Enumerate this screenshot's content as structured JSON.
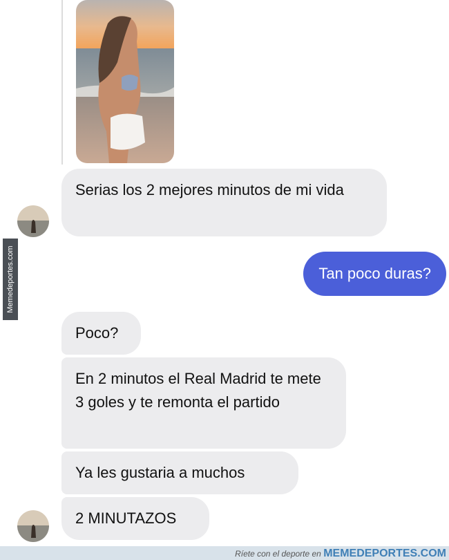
{
  "messages": {
    "received_1": "Serias los 2 mejores minutos de mi vida",
    "sent_1": "Tan poco duras?",
    "received_2": "Poco?",
    "received_3": "En 2 minutos el Real Madrid te mete 3 goles y te remonta el partido",
    "received_4": "Ya les gustaria a muchos",
    "received_5": "2 MINUTAZOS"
  },
  "watermark": {
    "side_text": "Memedeportes.com",
    "footer_prefix": "Ríete con el deporte en",
    "footer_brand": "MEMEDEPORTES.COM"
  },
  "colors": {
    "sent_bubble": "#4b5fd9",
    "received_bubble": "#ececee",
    "footer_bar": "#d8e2ea",
    "footer_brand": "#3f7fb6"
  }
}
